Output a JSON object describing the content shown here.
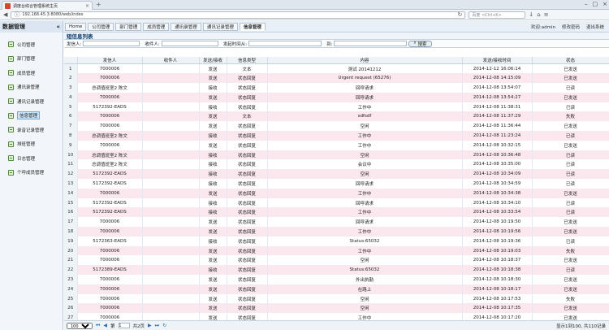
{
  "browser": {
    "tab_title": "调度台综合管理系统主页",
    "url": "192.168.45.3:8080/web/index",
    "search_placeholder": "百度 <Ctrl+K>"
  },
  "app": {
    "sidebar_title": "数据管理",
    "menu": [
      "Home",
      "公司管理",
      "部门管理",
      "成员管理",
      "通讯录管理",
      "通讯记录管理",
      "信息管理"
    ],
    "active_menu": 6,
    "user_label": "欢迎:admin",
    "change_password": "修改密码",
    "logout": "退出系统"
  },
  "sidebar": {
    "items": [
      "公司管理",
      "部门管理",
      "成员管理",
      "通讯录管理",
      "通讯记录管理",
      "信息管理",
      "录音记录管理",
      "排班管理",
      "日志管理",
      "个呼成员管理"
    ],
    "active": 5
  },
  "panel": {
    "title": "短信息列表",
    "filters": {
      "sender": "发信人:",
      "receiver": "收件人:",
      "time_from": "发起时间从:",
      "time_to": "到:",
      "search": "搜索"
    }
  },
  "grid": {
    "headers": [
      "",
      "发信人",
      "收件人",
      "发送/接收",
      "信息类型",
      "内容",
      "发送/接收时间",
      "状态"
    ],
    "rows": [
      [
        "1",
        "7000006",
        "",
        "发送",
        "文本",
        "测试 20141212",
        "2014-12-12 16:06:14",
        "已发送"
      ],
      [
        "2",
        "7000006",
        "",
        "发送",
        "状态回复",
        "Urgent request (65276)",
        "2014-12-08 14:15:09",
        "已发送"
      ],
      [
        "3",
        "总调值班室2 陈文",
        "",
        "接收",
        "状态回复",
        "回呼请求",
        "2014-12-08 13:54:07",
        "已读"
      ],
      [
        "4",
        "7000006",
        "",
        "发送",
        "状态回复",
        "回呼请求",
        "2014-12-08 13:54:27",
        "已发送"
      ],
      [
        "5",
        "5172392-EADS",
        "",
        "接收",
        "状态回复",
        "工作中",
        "2014-12-08 11:38:31",
        "已读"
      ],
      [
        "6",
        "7000006",
        "",
        "发送",
        "文本",
        "sdfsdf",
        "2014-12-08 11:37:29",
        "失败"
      ],
      [
        "7",
        "7000006",
        "",
        "发送",
        "状态回复",
        "空闲",
        "2014-12-08 11:36:44",
        "已发送"
      ],
      [
        "8",
        "总调值班室2 陈文",
        "",
        "接收",
        "状态回复",
        "工作中",
        "2014-12-08 11:23:24",
        "已读"
      ],
      [
        "9",
        "7000006",
        "",
        "发送",
        "状态回复",
        "工作中",
        "2014-12-08 10:32:15",
        "已发送"
      ],
      [
        "10",
        "总调值班室2 陈文",
        "",
        "接收",
        "状态回复",
        "空闲",
        "2014-12-08 10:36:48",
        "已读"
      ],
      [
        "11",
        "总调值班室2 陈文",
        "",
        "接收",
        "状态回复",
        "会议中",
        "2014-12-08 10:35:00",
        "已读"
      ],
      [
        "12",
        "5172392-EADS",
        "",
        "接收",
        "状态回复",
        "空闲",
        "2014-12-08 10:34:09",
        "已读"
      ],
      [
        "13",
        "5172392-EADS",
        "",
        "接收",
        "状态回复",
        "回呼请求",
        "2014-12-08 10:34:59",
        "已读"
      ],
      [
        "14",
        "7000006",
        "",
        "发送",
        "状态回复",
        "工作中",
        "2014-12-08 10:34:38",
        "已发送"
      ],
      [
        "15",
        "5172392-EADS",
        "",
        "接收",
        "状态回复",
        "回呼请求",
        "2014-12-08 10:34:10",
        "已读"
      ],
      [
        "16",
        "5172392-EADS",
        "",
        "接收",
        "状态回复",
        "工作中",
        "2014-12-08 10:33:54",
        "已读"
      ],
      [
        "17",
        "7000006",
        "",
        "发送",
        "状态回复",
        "回呼请求",
        "2014-12-08 10:19:50",
        "已发送"
      ],
      [
        "18",
        "7000006",
        "",
        "发送",
        "状态回复",
        "工作中",
        "2014-12-08 10:19:56",
        "已发送"
      ],
      [
        "19",
        "5172363-EADS",
        "",
        "接收",
        "状态回复",
        "Status:65032",
        "2014-12-08 10:19:36",
        "已读"
      ],
      [
        "20",
        "7000006",
        "",
        "发送",
        "状态回复",
        "工作中",
        "2014-12-08 10:19:03",
        "失败"
      ],
      [
        "21",
        "7000006",
        "",
        "发送",
        "状态回复",
        "空闲",
        "2014-12-08 10:18:37",
        "已发送"
      ],
      [
        "22",
        "5172389-EADS",
        "",
        "接收",
        "状态回复",
        "Status:65032",
        "2014-12-08 10:18:38",
        "已读"
      ],
      [
        "23",
        "7000006",
        "",
        "发送",
        "状态回复",
        "外出执勤",
        "2014-12-08 10:18:30",
        "已发送"
      ],
      [
        "24",
        "7000006",
        "",
        "发送",
        "状态回复",
        "在路上",
        "2014-12-08 10:18:17",
        "已发送"
      ],
      [
        "25",
        "7000006",
        "",
        "发送",
        "状态回复",
        "空闲",
        "2014-12-08 10:17:53",
        "失败"
      ],
      [
        "26",
        "7000006",
        "",
        "发送",
        "状态回复",
        "空闲",
        "2014-12-08 10:17:35",
        "已发送"
      ],
      [
        "27",
        "7000006",
        "",
        "发送",
        "状态回复",
        "工作中",
        "2014-12-08 10:17:20",
        "已发送"
      ]
    ]
  },
  "pager": {
    "page_size": "100",
    "page_label": "第",
    "page_value": "1",
    "page_total": "共2页",
    "info": "显示1到100, 共110记录"
  }
}
